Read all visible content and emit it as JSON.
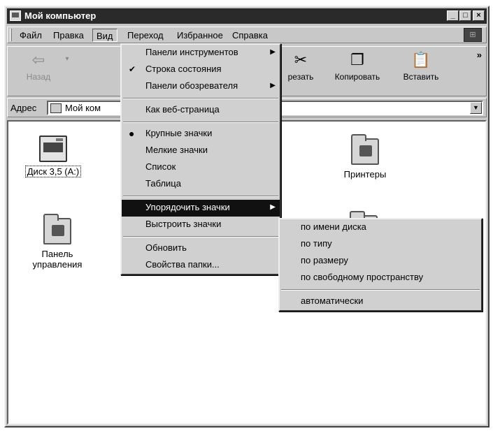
{
  "window": {
    "title": "Мой компьютер"
  },
  "menubar": [
    {
      "label": "Файл",
      "active": false
    },
    {
      "label": "Правка",
      "active": false
    },
    {
      "label": "Вид",
      "active": true
    },
    {
      "label": "Переход",
      "active": false
    },
    {
      "label": "Избранное",
      "active": false
    },
    {
      "label": "Справка",
      "active": false
    }
  ],
  "toolbar": {
    "back_label": "Назад",
    "cut_label": "резать",
    "copy_label": "Копировать",
    "paste_label": "Вставить",
    "chevron": "»"
  },
  "address": {
    "label": "Адрес",
    "value": "Мой ком"
  },
  "content": {
    "items": [
      {
        "label": "Диск 3,5 (A:)",
        "icon": "floppy-drive-icon",
        "selected": true
      },
      {
        "label": "Принтеры",
        "icon": "printers-folder-icon",
        "selected": false
      },
      {
        "label": "Панель управления",
        "icon": "control-panel-folder-icon",
        "selected": false
      }
    ]
  },
  "view_menu": {
    "items": [
      {
        "label": "Панели инструментов",
        "submenu": true
      },
      {
        "label": "Строка состояния",
        "checked": true
      },
      {
        "label": "Панели обозревателя",
        "submenu": true
      },
      {
        "label": "Как веб-страница"
      },
      {
        "label": "Крупные значки",
        "radio": true
      },
      {
        "label": "Мелкие значки"
      },
      {
        "label": "Список"
      },
      {
        "label": "Таблица"
      },
      {
        "label": "Упорядочить значки",
        "submenu": true,
        "highlighted": true
      },
      {
        "label": "Выстроить значки"
      },
      {
        "label": "Обновить"
      },
      {
        "label": "Свойства папки..."
      }
    ]
  },
  "arrange_submenu": {
    "items": [
      {
        "label": "по имени диска"
      },
      {
        "label": "по типу"
      },
      {
        "label": "по размеру"
      },
      {
        "label": "по свободному пространству"
      },
      {
        "label": "автоматически"
      }
    ]
  },
  "colors": {
    "title_bg": "#2a2a2a",
    "window_bg": "#c8c8c8",
    "highlight": "#111111"
  }
}
